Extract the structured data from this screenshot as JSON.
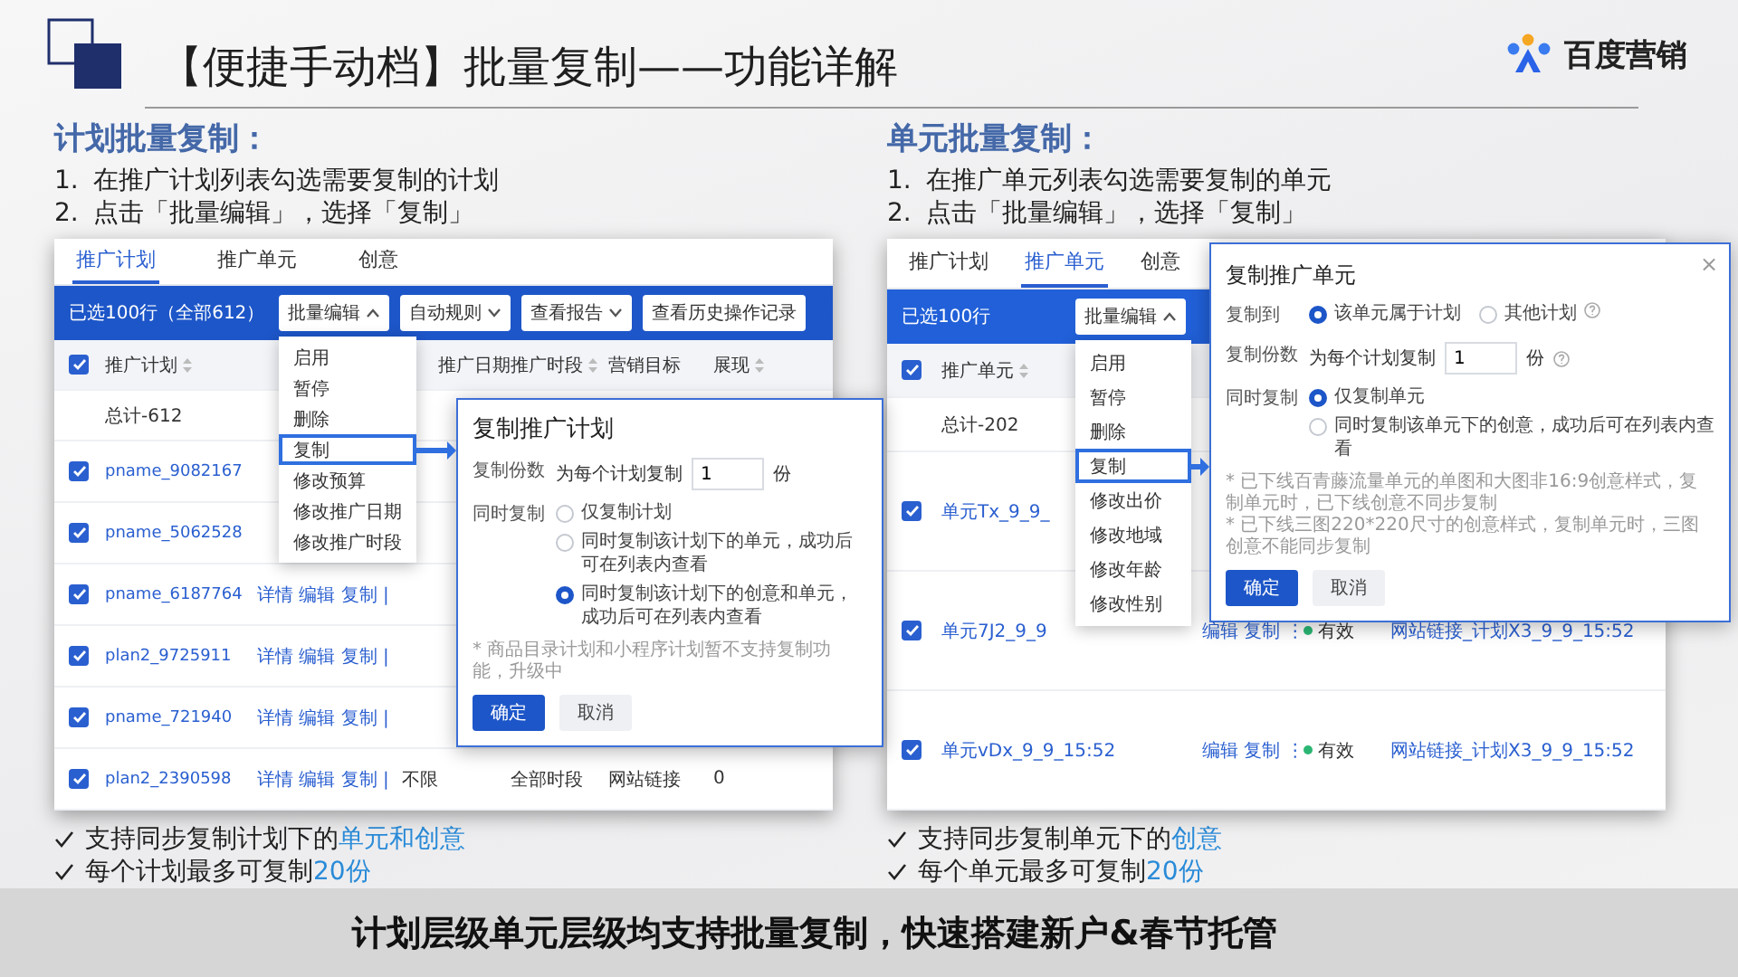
{
  "header": {
    "title": "【便捷手动档】批量复制——功能详解",
    "brand": "百度营销"
  },
  "sections": [
    {
      "kind": "plan",
      "heading": "计划批量复制：",
      "steps": [
        {
          "number": "1.",
          "text": "在推广计划列表勾选需要复制的计划"
        },
        {
          "number": "2.",
          "text": "点击「批量编辑」，选择「复制」"
        }
      ],
      "screen": {
        "tabs": [
          {
            "label": "推广计划",
            "selected": true
          },
          {
            "label": "推广单元",
            "selected": false
          },
          {
            "label": "创意",
            "selected": false
          }
        ],
        "selection": "已选100行（全部612）",
        "toolbar": [
          {
            "label": "批量编辑",
            "expanded": true
          },
          {
            "label": "自动规则",
            "expanded": false
          },
          {
            "label": "查看报告",
            "expanded": false
          },
          {
            "label": "查看历史操作记录"
          }
        ],
        "header_checked": true,
        "columns": [
          {
            "label": "推广计划",
            "sortable": true
          },
          {
            "label": "推广日期",
            "sortable": false
          },
          {
            "label": "推广时段",
            "sortable": true
          },
          {
            "label": "营销目标",
            "sortable": false
          },
          {
            "label": "展现",
            "sortable": true
          }
        ],
        "total": "总计-612",
        "rows": [
          {
            "checked": true,
            "name": "pname_9082167"
          },
          {
            "checked": true,
            "name": "pname_5062528"
          },
          {
            "checked": true,
            "name": "pname_6187764",
            "actions": "详情 编辑 复制 |"
          },
          {
            "checked": true,
            "name": "plan2_9725911",
            "actions": "详情 编辑 复制 |"
          },
          {
            "checked": true,
            "name": "pname_721940",
            "actions": "详情 编辑 复制 |"
          },
          {
            "checked": true,
            "name": "plan2_2390598",
            "actions": "详情 编辑 复制 |",
            "cells": [
              "不限",
              "全部时段",
              "网站链接",
              "0"
            ]
          }
        ],
        "menu": [
          {
            "label": "启用",
            "selected": false
          },
          {
            "label": "暂停",
            "selected": false
          },
          {
            "label": "删除",
            "selected": false
          },
          {
            "label": "复制",
            "selected": true
          },
          {
            "label": "修改预算",
            "selected": false
          },
          {
            "label": "修改推广日期",
            "selected": false
          },
          {
            "label": "修改推广时段",
            "selected": false
          }
        ],
        "dialog": {
          "title": "复制推广计划",
          "fields": [
            {
              "kind": "count",
              "label": "复制份数",
              "prefix": "为每个计划复制",
              "value": "1",
              "suffix": "份",
              "help": false
            },
            {
              "kind": "radios",
              "label": "同时复制",
              "inline": false,
              "options": [
                {
                  "label": "仅复制计划",
                  "selected": false
                },
                {
                  "label": "同时复制该计划下的单元，成功后可在列表内查看",
                  "selected": false
                },
                {
                  "label": "同时复制该计划下的创意和单元，成功后可在列表内查看",
                  "selected": true
                }
              ]
            }
          ],
          "notes": [
            "* 商品目录计划和小程序计划暂不支持复制功能，升级中"
          ],
          "buttons": [
            {
              "label": "确定",
              "primary": true
            },
            {
              "label": "取消",
              "primary": false
            }
          ]
        }
      },
      "bullets": [
        {
          "text": "支持同步复制计划下的",
          "highlight": "单元和创意"
        },
        {
          "text": "每个计划最多可复制",
          "highlight": "20份"
        }
      ]
    },
    {
      "kind": "unit",
      "heading": "单元批量复制：",
      "steps": [
        {
          "number": "1.",
          "text": "在推广单元列表勾选需要复制的单元"
        },
        {
          "number": "2.",
          "text": "点击「批量编辑」，选择「复制」"
        }
      ],
      "screen": {
        "tabs": [
          {
            "label": "推广计划",
            "selected": false
          },
          {
            "label": "推广单元",
            "selected": true
          },
          {
            "label": "创意",
            "selected": false
          }
        ],
        "selection": "已选100行",
        "toolbar": [
          {
            "label": "批量编辑",
            "expanded": true
          }
        ],
        "header_checked": true,
        "columns": [
          {
            "label": "推广单元",
            "sortable": true
          }
        ],
        "total": "总计-202",
        "rows": [
          {
            "checked": true,
            "name": "单元Tx_9_9_"
          },
          {
            "checked": true,
            "name": "单元7J2_9_9",
            "actions": "编辑 复制 ⋮",
            "cells": [
              "有效",
              "网站链接_计划X3_9_9_15:52"
            ]
          },
          {
            "checked": true,
            "name": "单元vDx_9_9_15:52",
            "actions": "编辑 复制 ⋮",
            "cells": [
              "有效",
              "网站链接_计划X3_9_9_15:52"
            ]
          }
        ],
        "menu": [
          {
            "label": "启用",
            "selected": false
          },
          {
            "label": "暂停",
            "selected": false
          },
          {
            "label": "删除",
            "selected": false
          },
          {
            "label": "复制",
            "selected": true
          },
          {
            "label": "修改出价",
            "selected": false
          },
          {
            "label": "修改地域",
            "selected": false
          },
          {
            "label": "修改年龄",
            "selected": false
          },
          {
            "label": "修改性别",
            "selected": false
          }
        ],
        "dialog": {
          "title": "复制推广单元",
          "close": "×",
          "fields": [
            {
              "kind": "radios",
              "label": "复制到",
              "inline": true,
              "options": [
                {
                  "label": "该单元属于计划",
                  "selected": true,
                  "help": false
                },
                {
                  "label": "其他计划",
                  "selected": false,
                  "help": true
                }
              ]
            },
            {
              "kind": "count",
              "label": "复制份数",
              "prefix": "为每个计划复制",
              "value": "1",
              "suffix": "份",
              "help": true
            },
            {
              "kind": "radios",
              "label": "同时复制",
              "inline": false,
              "options": [
                {
                  "label": "仅复制单元",
                  "selected": true
                },
                {
                  "label": "同时复制该单元下的创意，成功后可在列表内查看",
                  "selected": false
                }
              ]
            }
          ],
          "notes": [
            "* 已下线百青藤流量单元的单图和大图非16:9创意样式，复制单元时，已下线创意不同步复制",
            "* 已下线三图220*220尺寸的创意样式，复制单元时，三图创意不能同步复制"
          ],
          "buttons": [
            {
              "label": "确定",
              "primary": true
            },
            {
              "label": "取消",
              "primary": false
            }
          ]
        }
      },
      "bullets": [
        {
          "text": "支持同步复制单元下的",
          "highlight": "创意"
        },
        {
          "text": "每个单元最多可复制",
          "highlight": "20份"
        }
      ]
    }
  ],
  "banner": "计划层级单元层级均支持批量复制，快速搭建新户&春节托管"
}
